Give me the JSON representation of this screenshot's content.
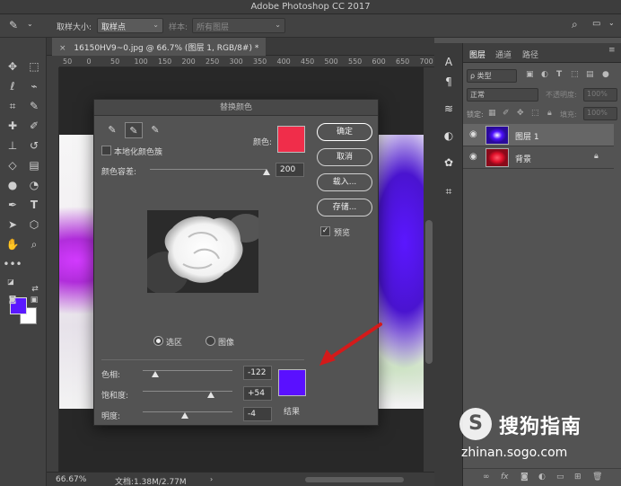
{
  "window": {
    "title": "Adobe Photoshop CC 2017"
  },
  "options_bar": {
    "tool_icon": "eyedropper-icon",
    "sample_size_label": "取样大小:",
    "sample_size_value": "取样点",
    "sample_label": "样本:",
    "sample_value": "所有图层"
  },
  "document": {
    "tab_title": "16150HV9~0.jpg @ 66.7% (图层 1, RGB/8#) *",
    "ruler_ticks": [
      "50",
      "0",
      "50",
      "100",
      "150",
      "200",
      "250",
      "300",
      "350",
      "400",
      "450",
      "500",
      "550",
      "600",
      "650",
      "700",
      "750"
    ],
    "zoom": "66.67%",
    "doc_size": "文档:1.38M/2.77M"
  },
  "colors": {
    "foreground": "#5a18ff",
    "background": "#ffffff",
    "replace_color": "#f02d4a",
    "result_color": "#5a10ff",
    "arrow": "#d41a1a"
  },
  "dialog": {
    "title": "替换颜色",
    "localized_clusters": "本地化颜色簇",
    "color_label": "颜色:",
    "fuzziness_label": "颜色容差:",
    "fuzziness_value": "200",
    "fuzziness_fraction": 1.0,
    "buttons": {
      "ok": "确定",
      "cancel": "取消",
      "load": "载入...",
      "save": "存储..."
    },
    "preview_label": "预览",
    "radio_selection": "选区",
    "radio_image": "图像",
    "hue_label": "色相:",
    "hue_value": "-122",
    "saturation_label": "饱和度:",
    "saturation_value": "+54",
    "lightness_label": "明度:",
    "lightness_value": "-4",
    "result_label": "结果"
  },
  "layers_panel": {
    "tabs": [
      "图层",
      "通道",
      "路径"
    ],
    "filter_kind": "ρ 类型",
    "blend_mode": "正常",
    "opacity_label": "不透明度:",
    "opacity_value": "100%",
    "lock_label": "锁定:",
    "fill_label": "填充:",
    "fill_value": "100%",
    "layers": [
      {
        "name": "图层 1",
        "selected": true
      },
      {
        "name": "背景",
        "selected": false,
        "locked": true
      }
    ]
  },
  "watermark": {
    "logo_letter": "S",
    "name": "搜狗指南",
    "url": "zhinan.sogo.com"
  }
}
